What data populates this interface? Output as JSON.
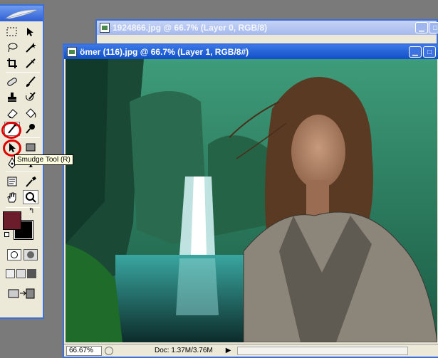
{
  "toolbox": {
    "tooltip": "Smudge Tool (R)"
  },
  "colors": {
    "foreground": "#6b1d2c",
    "background": "#000000",
    "annotation": "#e10000",
    "title_active": "#0f4fc8",
    "title_inactive": "#a6b9ec"
  },
  "windows": {
    "back": {
      "title": "1924866.jpg @ 66.7% (Layer 0, RGB/8)"
    },
    "front": {
      "title": "ömer (116).jpg @ 66.7% (Layer 1, RGB/8#)",
      "zoom": "66.67%",
      "doc_info": "Doc: 1.37M/3.76M"
    }
  },
  "icons": [
    "marquee-icon",
    "move-icon",
    "lasso-icon",
    "magic-wand-icon",
    "crop-icon",
    "slice-icon",
    "healing-brush-icon",
    "brush-icon",
    "clone-stamp-icon",
    "history-brush-icon",
    "eraser-icon",
    "paint-bucket-icon",
    "smudge-icon",
    "dodge-icon",
    "path-select-icon",
    "rectangle-shape-icon",
    "pen-icon",
    "type-icon",
    "notes-icon",
    "eyedropper-icon",
    "hand-icon",
    "zoom-icon"
  ]
}
